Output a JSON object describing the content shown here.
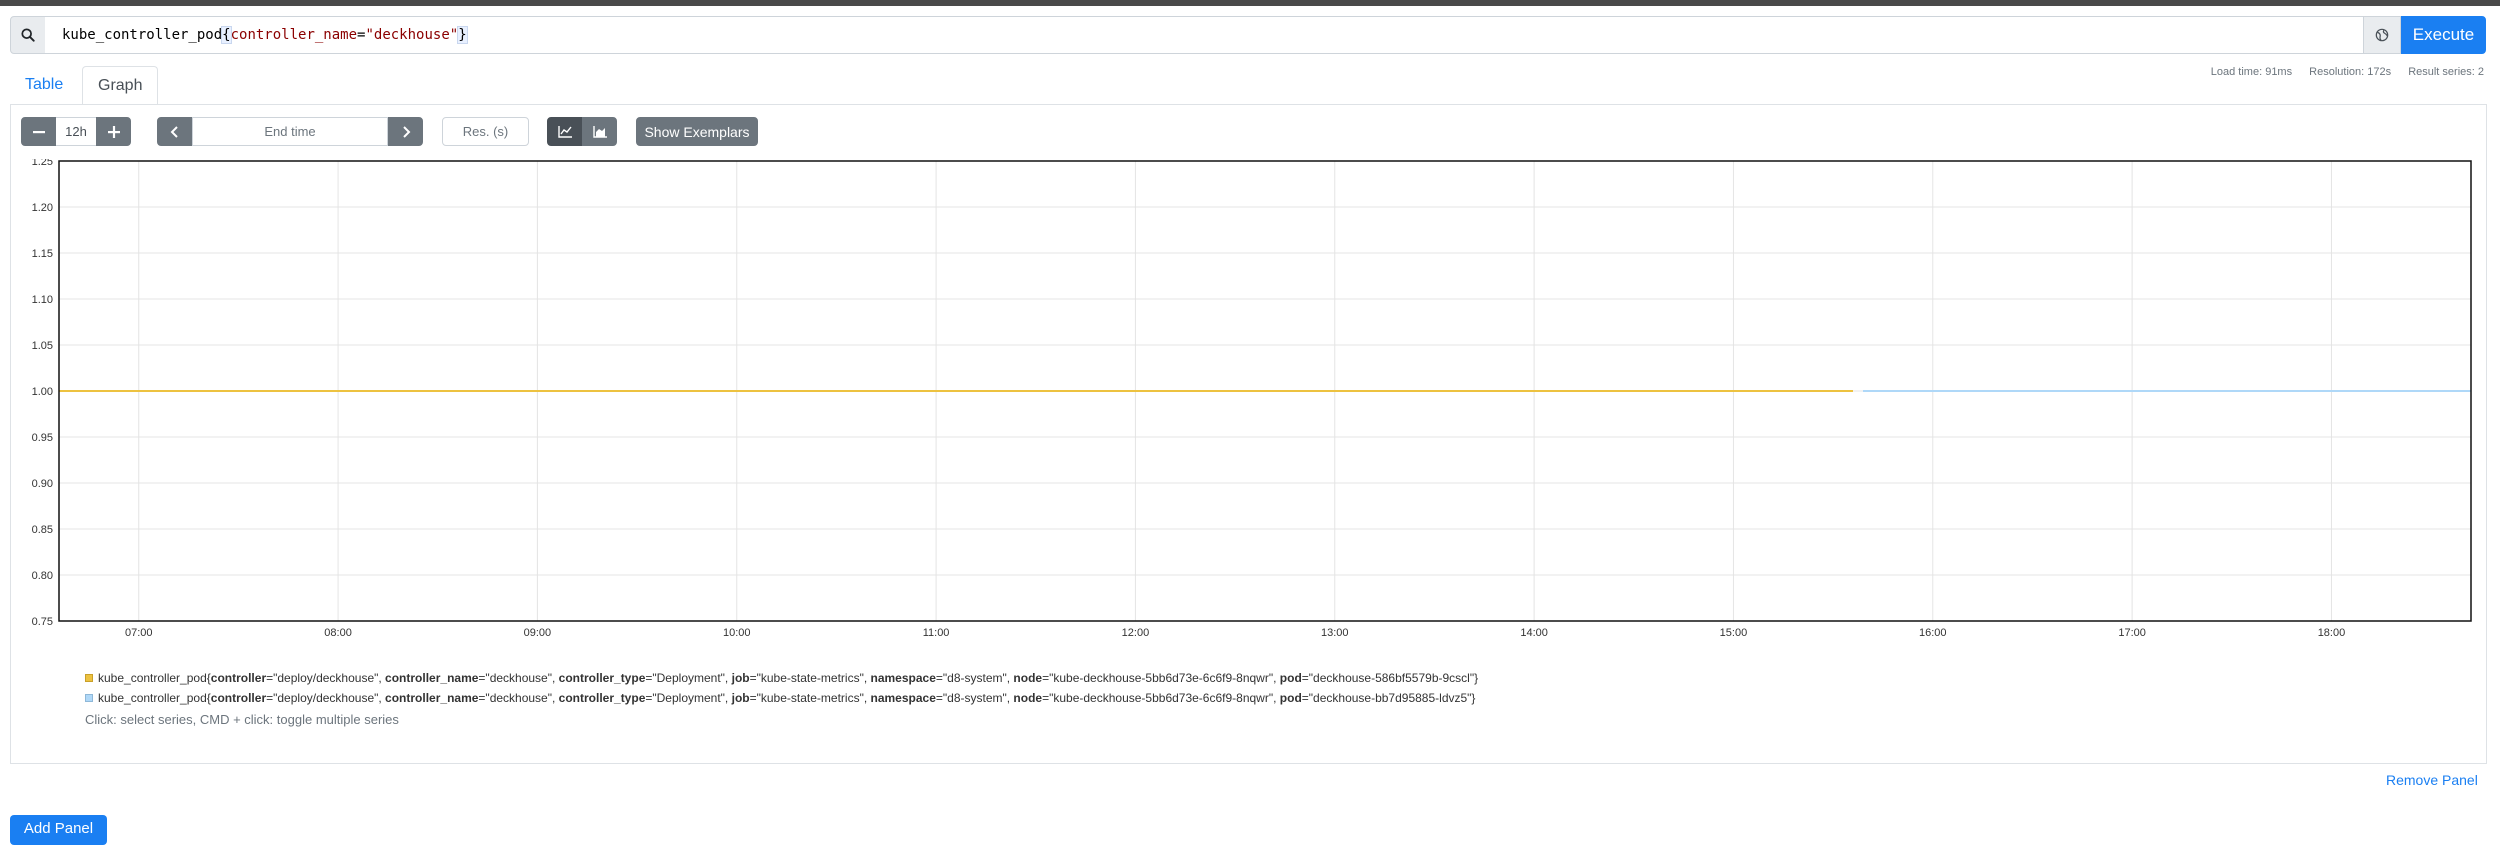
{
  "query": {
    "metric": "kube_controller_pod",
    "open_brace": "{",
    "label_name": "controller_name",
    "operator": "=",
    "label_value": "\"deckhouse\"",
    "close_brace": "}",
    "execute_label": "Execute"
  },
  "tabs": [
    {
      "label": "Table"
    },
    {
      "label": "Graph"
    }
  ],
  "stats": {
    "load_time": "Load time: 91ms",
    "resolution": "Resolution: 172s",
    "result_series": "Result series: 2"
  },
  "controls": {
    "range_value": "12h",
    "end_time_placeholder": "End time",
    "resolution_placeholder": "Res. (s)",
    "exemplars_label": "Show Exemplars"
  },
  "legend": {
    "series": [
      {
        "metric": "kube_controller_pod",
        "labels": [
          {
            "k": "controller",
            "v": "\"deploy/deckhouse\""
          },
          {
            "k": "controller_name",
            "v": "\"deckhouse\""
          },
          {
            "k": "controller_type",
            "v": "\"Deployment\""
          },
          {
            "k": "job",
            "v": "\"kube-state-metrics\""
          },
          {
            "k": "namespace",
            "v": "\"d8-system\""
          },
          {
            "k": "node",
            "v": "\"kube-deckhouse-5bb6d73e-6c6f9-8nqwr\""
          },
          {
            "k": "pod",
            "v": "\"deckhouse-586bf5579b-9cscl\""
          }
        ]
      },
      {
        "metric": "kube_controller_pod",
        "labels": [
          {
            "k": "controller",
            "v": "\"deploy/deckhouse\""
          },
          {
            "k": "controller_name",
            "v": "\"deckhouse\""
          },
          {
            "k": "controller_type",
            "v": "\"Deployment\""
          },
          {
            "k": "job",
            "v": "\"kube-state-metrics\""
          },
          {
            "k": "namespace",
            "v": "\"d8-system\""
          },
          {
            "k": "node",
            "v": "\"kube-deckhouse-5bb6d73e-6c6f9-8nqwr\""
          },
          {
            "k": "pod",
            "v": "\"deckhouse-bb7d95885-ldvz5\""
          }
        ]
      }
    ],
    "hint": "Click: select series, CMD + click: toggle multiple series"
  },
  "remove_panel_label": "Remove Panel",
  "add_panel_label": "Add Panel",
  "chart_data": {
    "type": "line",
    "title": "",
    "xlabel": "",
    "ylabel": "",
    "x_ticks": [
      "07:00",
      "08:00",
      "09:00",
      "10:00",
      "11:00",
      "12:00",
      "13:00",
      "14:00",
      "15:00",
      "16:00",
      "17:00",
      "18:00"
    ],
    "xlim": [
      "06:36",
      "18:42"
    ],
    "ylim": [
      0.75,
      1.25
    ],
    "y_ticks": [
      0.75,
      0.8,
      0.85,
      0.9,
      0.95,
      1.0,
      1.05,
      1.1,
      1.15,
      1.2,
      1.25
    ],
    "grid": true,
    "series": [
      {
        "color": "#edc240",
        "x": [
          "06:36",
          "15:36"
        ],
        "values": [
          1,
          1
        ]
      },
      {
        "color": "#afd8f8",
        "x": [
          "15:39",
          "18:42"
        ],
        "values": [
          1,
          1
        ]
      }
    ]
  },
  "colors": {
    "accent": "#1a7ff2",
    "series_1": "#edc240",
    "series_2": "#afd8f8"
  }
}
